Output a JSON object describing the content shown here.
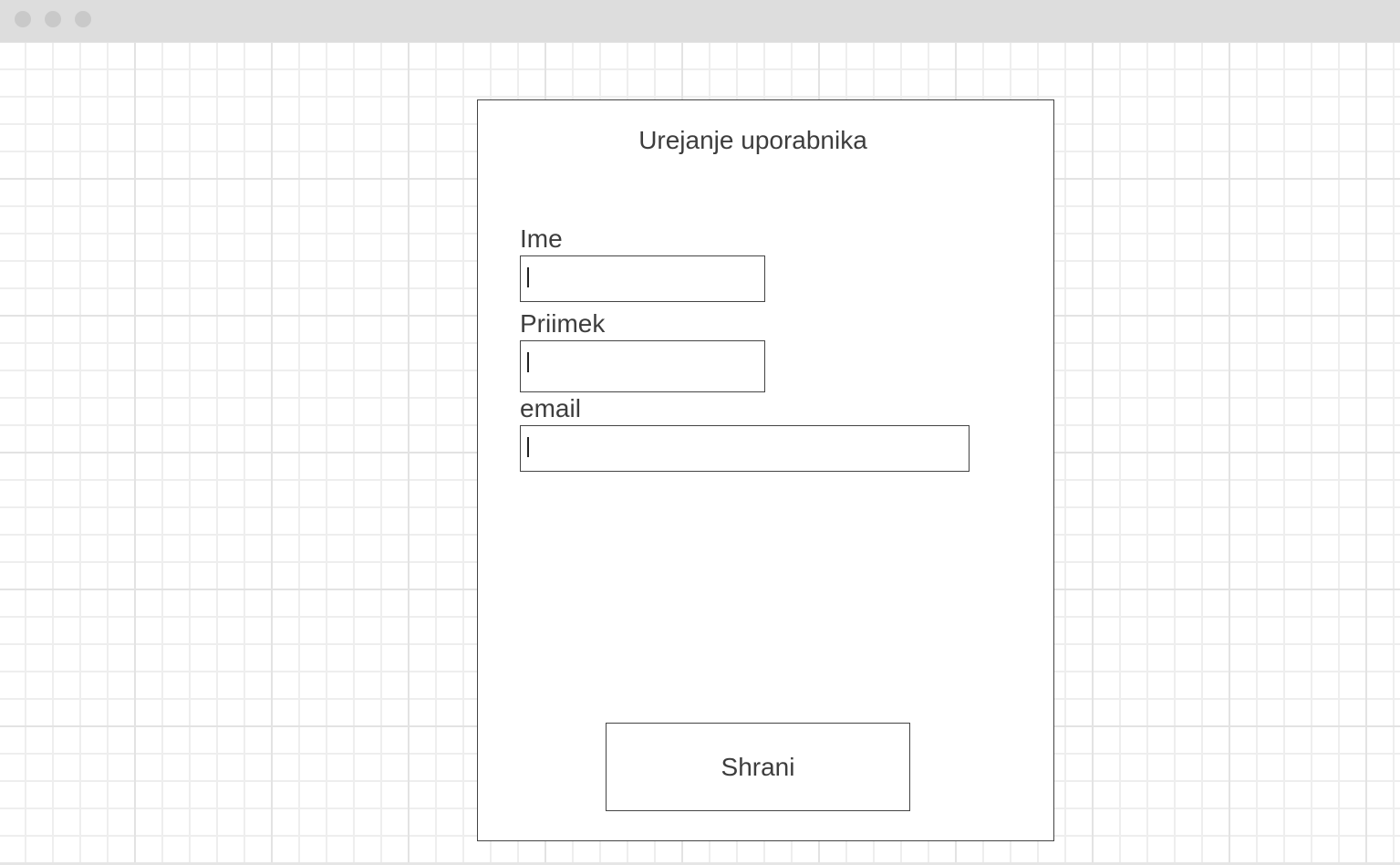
{
  "window": {
    "controls": [
      "close",
      "minimize",
      "maximize"
    ]
  },
  "form": {
    "title": "Urejanje uporabnika",
    "fields": [
      {
        "label": "Ime",
        "value": ""
      },
      {
        "label": "Priimek",
        "value": ""
      },
      {
        "label": "email",
        "value": ""
      }
    ],
    "save_label": "Shrani"
  }
}
